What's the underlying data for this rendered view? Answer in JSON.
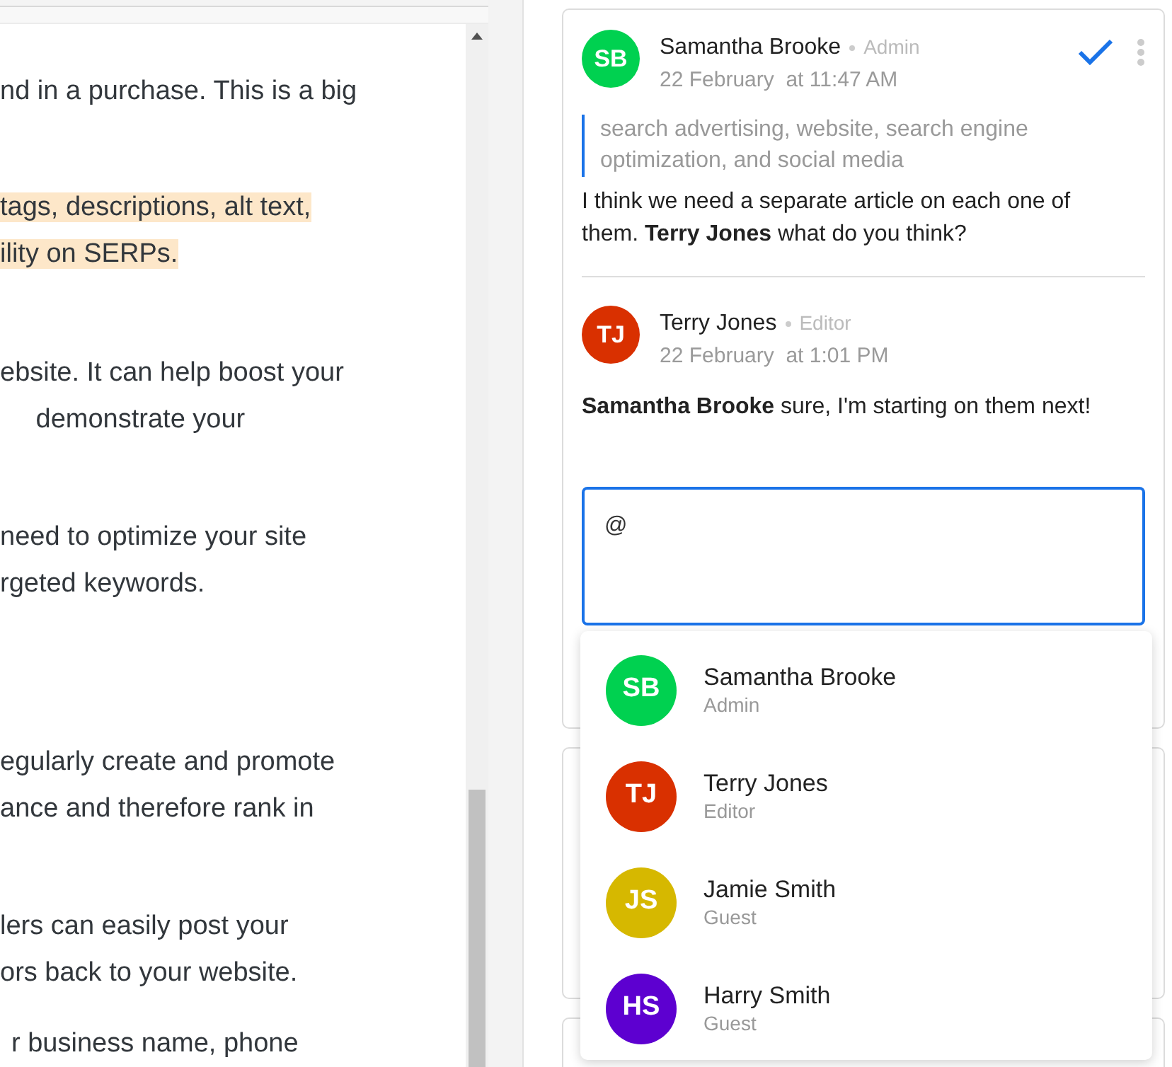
{
  "editor": {
    "paragraphs": [
      {
        "lines": [
          "nd in a purchase. This is a big"
        ],
        "highlighted": false
      },
      {
        "lines": [
          "tags, descriptions, alt text,",
          "ility on SERPs."
        ],
        "highlighted": true
      },
      {
        "lines": [
          "ebsite. It can help boost your",
          " demonstrate your"
        ],
        "highlighted": false
      },
      {
        "lines": [
          "need to optimize your site",
          "rgeted keywords."
        ],
        "highlighted": false
      },
      {
        "lines": [
          "egularly create and promote",
          "ance and therefore rank in"
        ],
        "highlighted": false
      },
      {
        "lines": [
          "lers can easily post your",
          "ors back to your website."
        ],
        "highlighted": false
      },
      {
        "lines": [
          "r business name, phone"
        ],
        "highlighted": false
      }
    ]
  },
  "comment_cards": [
    {
      "entries": [
        {
          "initials": "SB",
          "color": "#00d150",
          "author": "Samantha Brooke",
          "role": "Admin",
          "date": "22 February  at 11:47 AM",
          "quote": "search advertising, website, search engine optimization, and social media",
          "text": "I think we need a separate article on each one of them. **Terry Jones** what do you think?"
        },
        {
          "initials": "TJ",
          "color": "#d93000",
          "author": "Terry Jones",
          "role": "Editor",
          "date": "22 February  at 1:01 PM",
          "text": "**Samantha Brooke** sure, I'm starting on them next!"
        }
      ],
      "reply": {
        "value": "@",
        "focused": true
      }
    }
  ],
  "mention_menu": [
    {
      "initials": "SB",
      "color": "#00d150",
      "name": "Samantha Brooke",
      "role": "Admin"
    },
    {
      "initials": "TJ",
      "color": "#d93000",
      "name": "Terry Jones",
      "role": "Editor"
    },
    {
      "initials": "JS",
      "color": "#d6b800",
      "name": "Jamie Smith",
      "role": "Guest"
    },
    {
      "initials": "HS",
      "color": "#5d00d0",
      "name": "Harry Smith",
      "role": "Guest"
    }
  ]
}
